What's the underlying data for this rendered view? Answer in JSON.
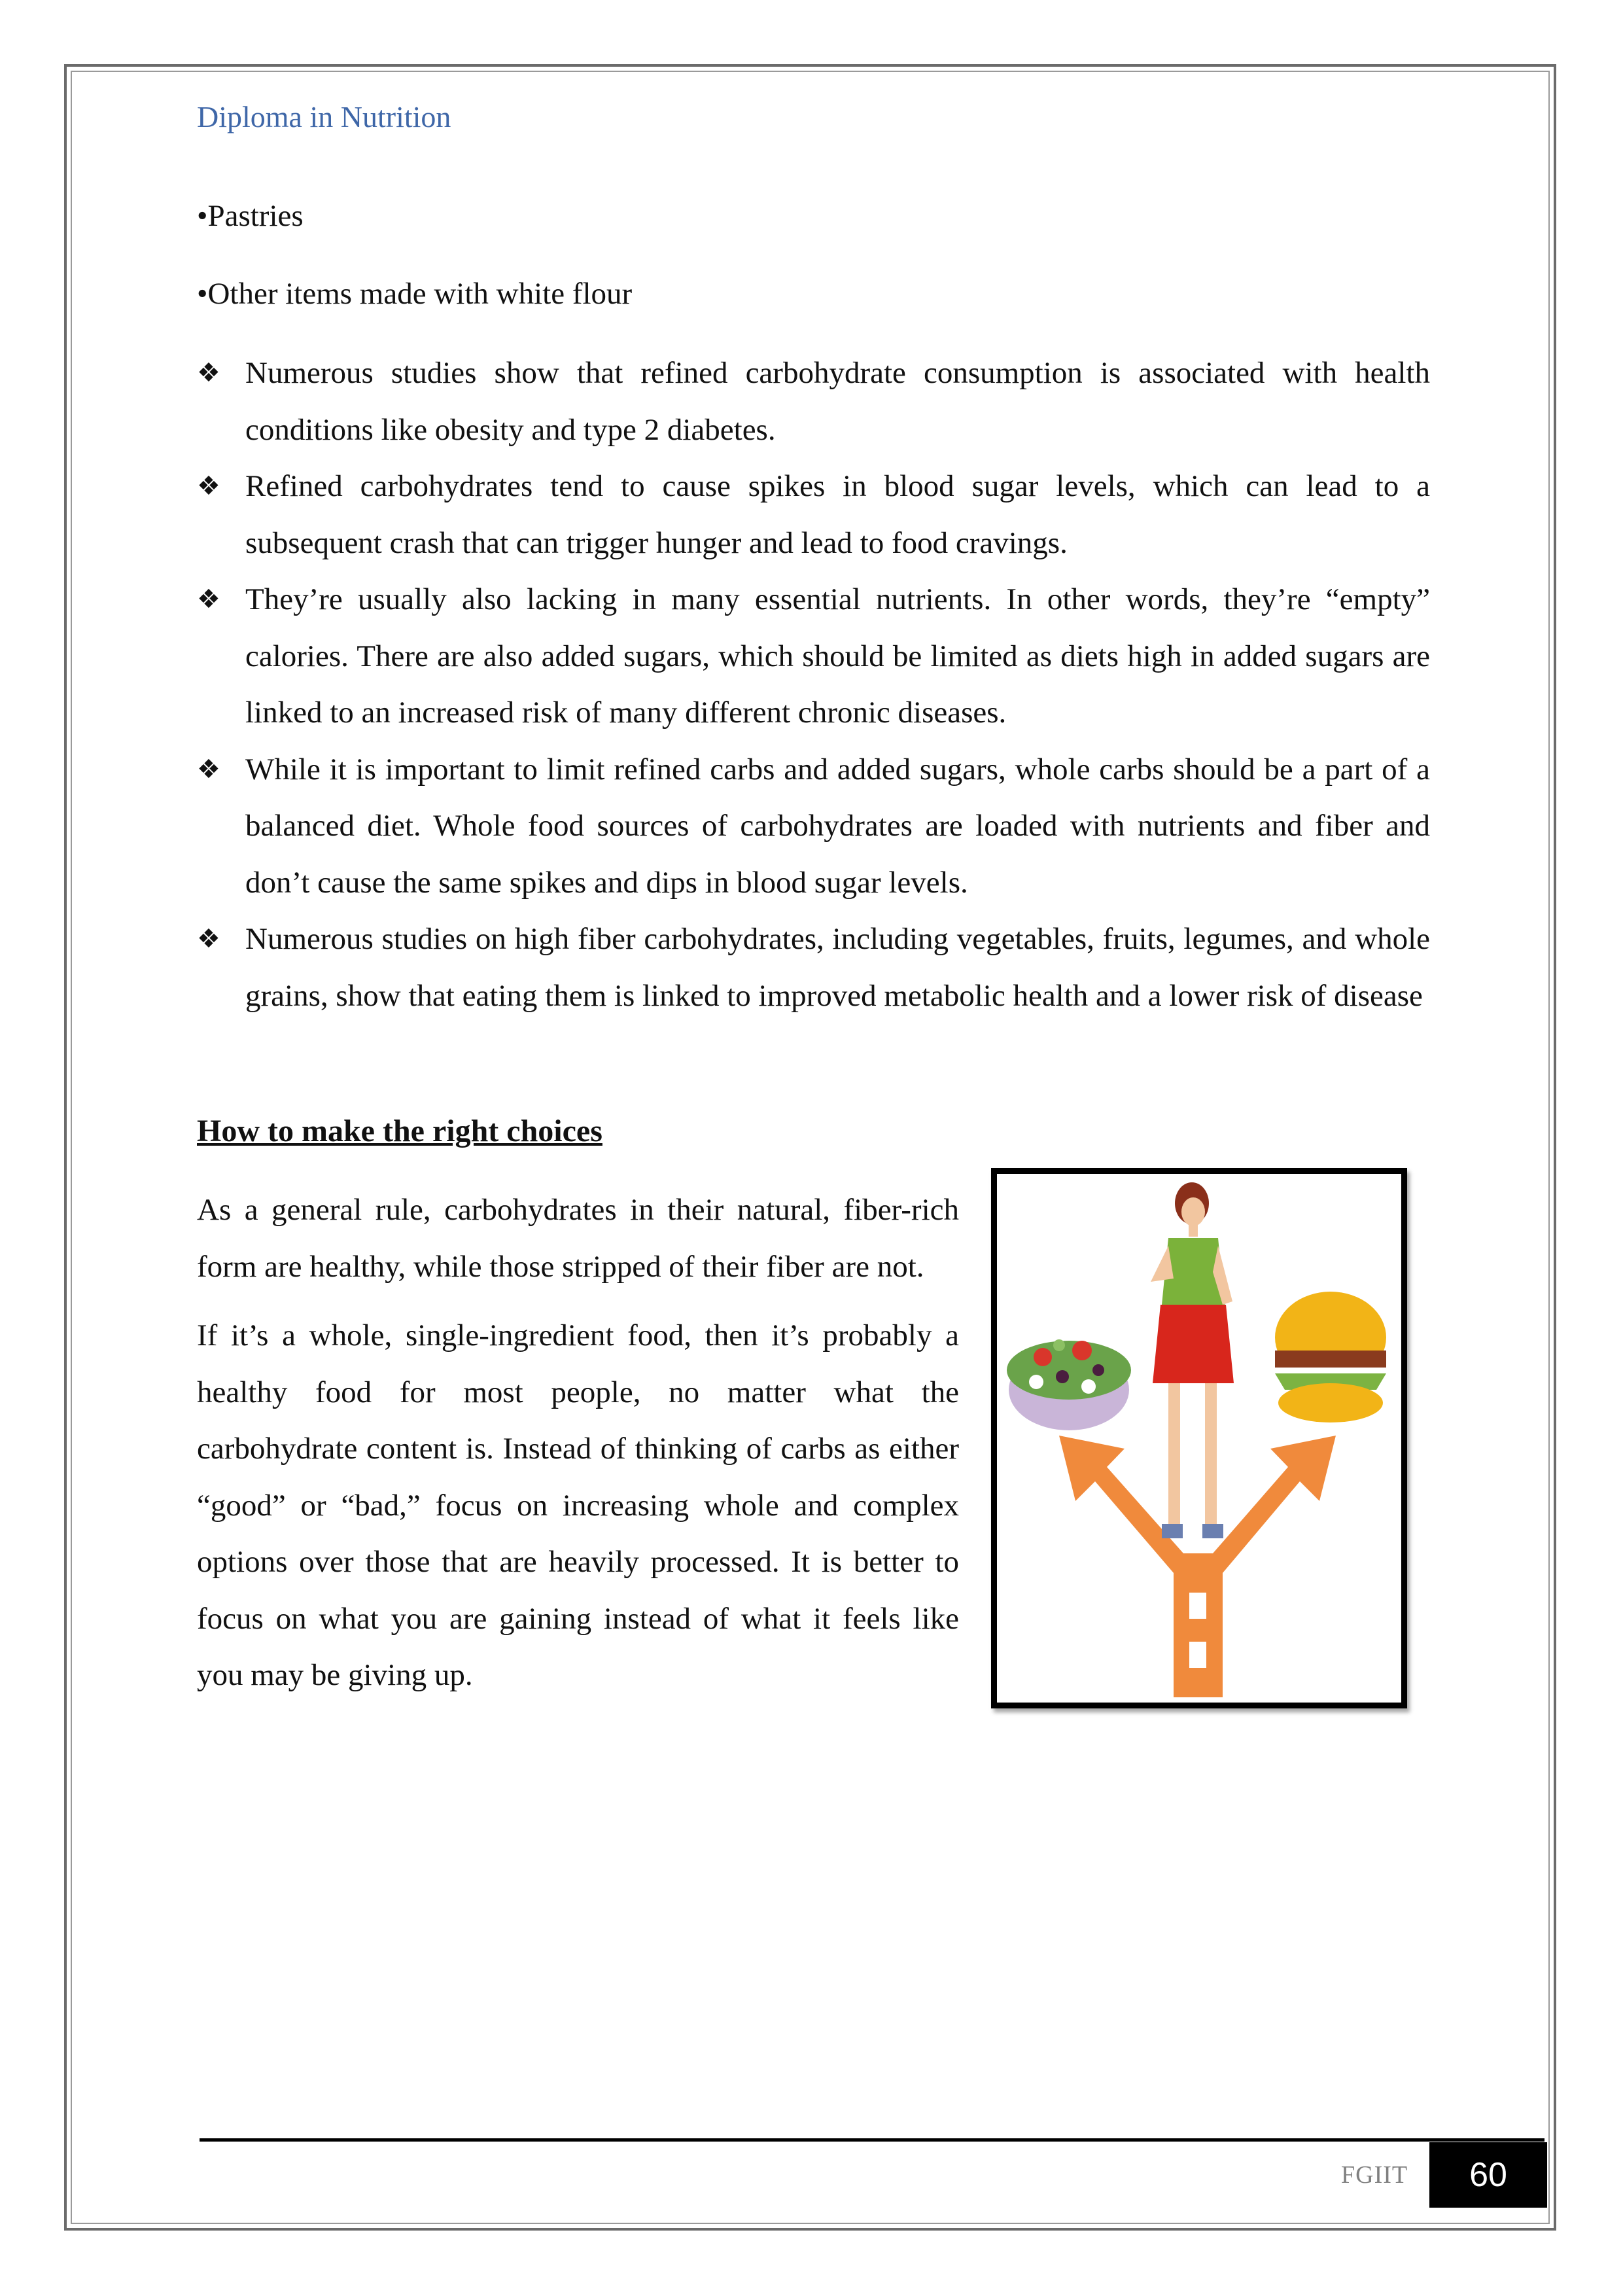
{
  "header": {
    "running_title": "Diploma in Nutrition"
  },
  "plain_bullets": [
    "•Pastries",
    "•Other items made with white flour"
  ],
  "diamond_bullets": [
    "Numerous studies show that refined carbohydrate consumption is associated with health conditions like obesity and type 2 diabetes.",
    "Refined carbohydrates tend to cause spikes in blood sugar levels, which can lead to a subsequent crash that can trigger hunger and lead to food cravings.",
    "They’re usually also lacking in many essential nutrients. In other words, they’re “empty” calories. There are also added sugars, which should be limited as diets high in added sugars are linked to an increased risk of many different chronic diseases.",
    "While it is important to limit refined carbs and added sugars, whole carbs should be a part of a balanced diet. Whole food sources of carbohydrates are loaded with nutrients and fiber and don’t cause the same spikes and dips in blood sugar levels.",
    "Numerous studies on high fiber carbohydrates, including vegetables, fruits, legumes, and whole grains, show that eating them is linked to improved metabolic health and a lower risk of disease"
  ],
  "bullet_icon": "diamond-four-petal-icon",
  "section": {
    "heading": "How to make the right choices",
    "paragraphs": [
      "As a general rule, carbohydrates in their natural, fiber-rich form are healthy, while those stripped of their fiber are not.",
      "If it’s a whole, single-ingredient food, then it’s probably a healthy food for most people, no matter what the carbohydrate content is. Instead of thinking of carbs as either “good” or “bad,” focus on increasing whole and complex options over those that are heavily processed. It is better to focus on what you are gaining instead of what it feels like you may be giving up."
    ]
  },
  "figure": {
    "description_icon": "woman-choosing-salad-or-burger-illustration"
  },
  "footer": {
    "org": "FGIIT",
    "page_number": "60"
  },
  "colors": {
    "header_text": "#3f67a8",
    "arrow": "#f08a3c",
    "footer_text": "#808080"
  }
}
